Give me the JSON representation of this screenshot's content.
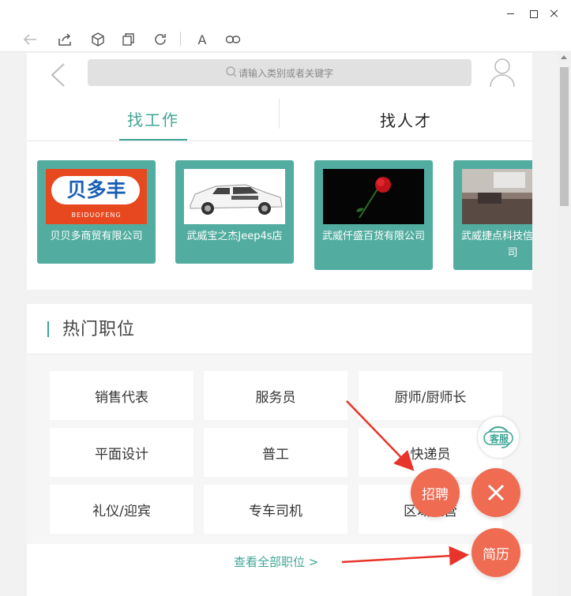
{
  "window": {
    "controls": [
      "minimize",
      "maximize",
      "close"
    ]
  },
  "toolbar": {
    "font_button": "A"
  },
  "header": {
    "search_placeholder": "请输入类别或者关键字"
  },
  "tabs": [
    {
      "label": "找工作",
      "active": true
    },
    {
      "label": "找人才",
      "active": false
    }
  ],
  "companies": [
    {
      "name": "贝贝多商贸有限公司",
      "logo_text": "贝多丰",
      "logo_sub": "BEIDUOFENG"
    },
    {
      "name": "武威宝之杰Jeep4s店"
    },
    {
      "name": "武威仟盛百货有限公司"
    },
    {
      "name": "武威捷点科技信息限公司"
    }
  ],
  "hot_jobs": {
    "title": "热门职位",
    "items": [
      "销售代表",
      "服务员",
      "厨师/厨师长",
      "平面设计",
      "普工",
      "快递员",
      "礼仪/迎宾",
      "专车司机",
      "区域经营"
    ],
    "view_all": "查看全部职位 >"
  },
  "floating": {
    "service": "客服",
    "recruit": "招聘",
    "resume": "简历"
  },
  "colors": {
    "accent": "#3fa695",
    "card": "#52ada0",
    "fab": "#ef6b52",
    "arrow": "#e8342a"
  }
}
